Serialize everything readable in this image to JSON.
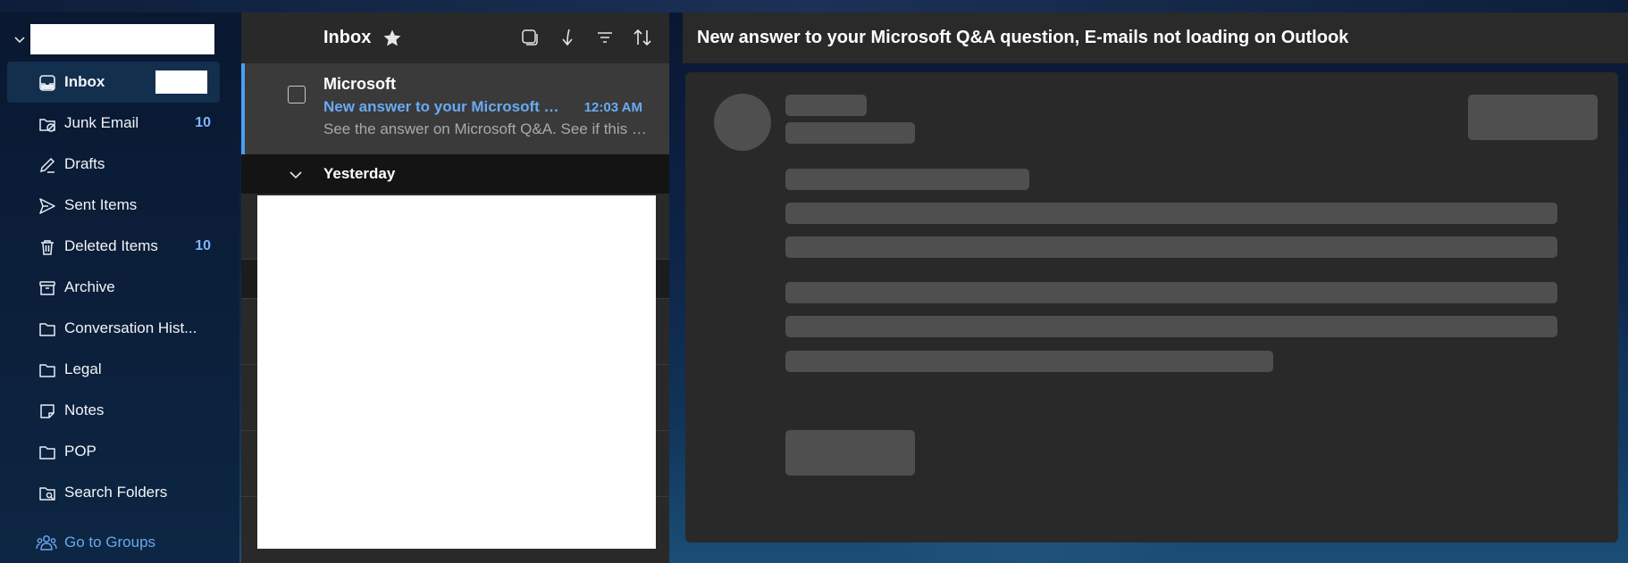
{
  "mail_folders": {
    "items": [
      {
        "label": "Inbox",
        "icon": "inbox-icon",
        "count": ""
      },
      {
        "label": "Junk Email",
        "icon": "junk-icon",
        "count": "10"
      },
      {
        "label": "Drafts",
        "icon": "pencil-icon",
        "count": ""
      },
      {
        "label": "Sent Items",
        "icon": "send-icon",
        "count": ""
      },
      {
        "label": "Deleted Items",
        "icon": "trash-icon",
        "count": "10"
      },
      {
        "label": "Archive",
        "icon": "archive-icon",
        "count": ""
      },
      {
        "label": "Conversation Hist...",
        "icon": "folder-icon",
        "count": ""
      },
      {
        "label": "Legal",
        "icon": "folder-icon",
        "count": ""
      },
      {
        "label": "Notes",
        "icon": "note-icon",
        "count": ""
      },
      {
        "label": "POP",
        "icon": "folder-icon",
        "count": ""
      },
      {
        "label": "Search Folders",
        "icon": "search-folder-icon",
        "count": ""
      }
    ],
    "go_to_groups": "Go to Groups"
  },
  "message_list": {
    "title": "Inbox",
    "selected_message": {
      "sender": "Microsoft",
      "subject": "New answer to your Microsoft Q&A question, E-mails not loading on Outlook",
      "time": "12:03 AM",
      "preview": "See the answer on Microsoft Q&A. See if this answer solves your question."
    },
    "group_label": "Yesterday"
  },
  "reading_pane": {
    "subject": "New answer to your Microsoft Q&A question, E-mails not loading on Outlook"
  },
  "colors": {
    "accent": "#69aaf5",
    "selected_bar": "#4aa0f4",
    "panel": "#292929",
    "skeleton": "#4f4f4f"
  }
}
